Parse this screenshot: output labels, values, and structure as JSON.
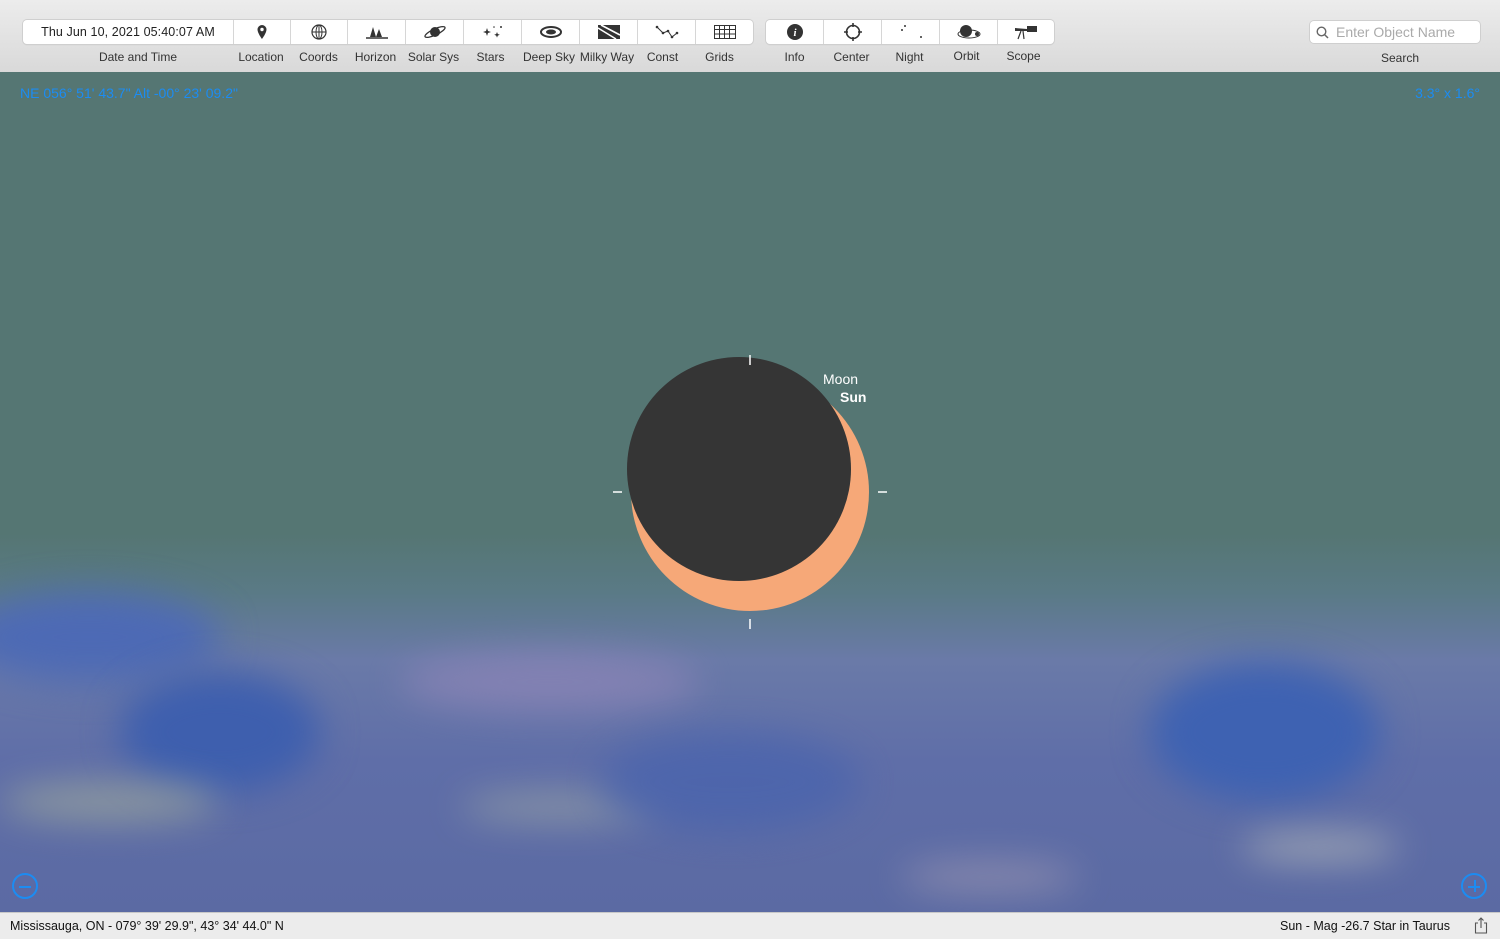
{
  "toolbar": {
    "datetime": "Thu Jun 10, 2021  05:40:07 AM",
    "datetime_label": "Date and Time",
    "buttons": [
      {
        "label": "Location",
        "icon": "location-pin-icon"
      },
      {
        "label": "Coords",
        "icon": "coords-icon"
      },
      {
        "label": "Horizon",
        "icon": "horizon-trees-icon"
      },
      {
        "label": "Solar Sys",
        "icon": "saturn-icon"
      },
      {
        "label": "Stars",
        "icon": "stars-icon"
      },
      {
        "label": "Deep Sky",
        "icon": "galaxy-icon"
      },
      {
        "label": "Milky Way",
        "icon": "milky-way-icon"
      },
      {
        "label": "Const",
        "icon": "constellation-icon"
      },
      {
        "label": "Grids",
        "icon": "grid-icon"
      }
    ],
    "buttons2": [
      {
        "label": "Info",
        "icon": "info-icon"
      },
      {
        "label": "Center",
        "icon": "center-crosshair-icon"
      },
      {
        "label": "Night",
        "icon": "night-moon-icon"
      },
      {
        "label": "Orbit",
        "icon": "orbit-icon"
      },
      {
        "label": "Scope",
        "icon": "telescope-icon"
      }
    ],
    "search_placeholder": "Enter Object Name",
    "search_label": "Search"
  },
  "sky": {
    "pointer_readout": "NE 056° 51' 43.7\" Alt -00° 23' 09.2\"",
    "field_of_view": "3.3° x  1.6°",
    "moon_label": "Moon",
    "sun_label": "Sun",
    "colors": {
      "sky": "#557673",
      "sun": "#f6a878",
      "moon": "#353535",
      "accent": "#1c8cf2"
    }
  },
  "zoom": {
    "out_icon": "zoom-out-icon",
    "in_icon": "zoom-in-icon"
  },
  "status": {
    "location": "Mississauga, ON - 079° 39' 29.9\", 43° 34' 44.0\" N",
    "selected_object": "Sun - Mag -26.7 Star in Taurus",
    "share_icon": "share-icon"
  }
}
